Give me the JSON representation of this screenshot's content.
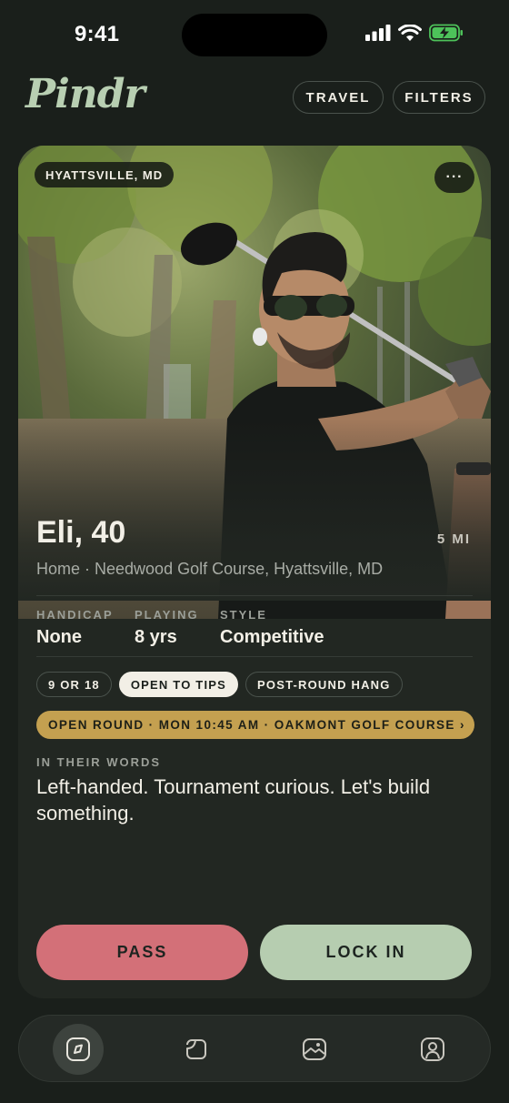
{
  "status_bar": {
    "time": "9:41"
  },
  "header": {
    "logo": "Pindr",
    "travel_label": "TRAVEL",
    "filters_label": "FILTERS"
  },
  "profile": {
    "location_badge": "HYATTSVILLE, MD",
    "more_label": "···",
    "name_age": "Eli, 40",
    "distance": "5 MI",
    "home": "Home · Needwood Golf Course, Hyattsville, MD",
    "stats": [
      {
        "label": "HANDICAP",
        "value": "None"
      },
      {
        "label": "PLAYING",
        "value": "8 yrs"
      },
      {
        "label": "STYLE",
        "value": "Competitive"
      }
    ],
    "tags": [
      {
        "label": "9 OR 18",
        "active": false
      },
      {
        "label": "OPEN TO TIPS",
        "active": true
      },
      {
        "label": "POST-ROUND HANG",
        "active": false
      }
    ],
    "open_round": "OPEN ROUND · MON 10:45 AM · OAKMONT GOLF COURSE ›",
    "words_label": "IN THEIR WORDS",
    "words": "Left-handed. Tournament curious. Let's build something."
  },
  "actions": {
    "pass_label": "PASS",
    "lock_label": "LOCK IN"
  },
  "tabbar": {
    "tabs": [
      {
        "icon": "discover-icon",
        "active": true
      },
      {
        "icon": "rounds-icon",
        "active": false
      },
      {
        "icon": "photos-icon",
        "active": false
      },
      {
        "icon": "profile-icon",
        "active": false
      }
    ]
  },
  "colors": {
    "background": "#1a1f1b",
    "card": "#222722",
    "logo": "#b8cfb2",
    "pass": "#d37078",
    "lock_in": "#b6cdb0",
    "open_round": "#c4a050"
  }
}
